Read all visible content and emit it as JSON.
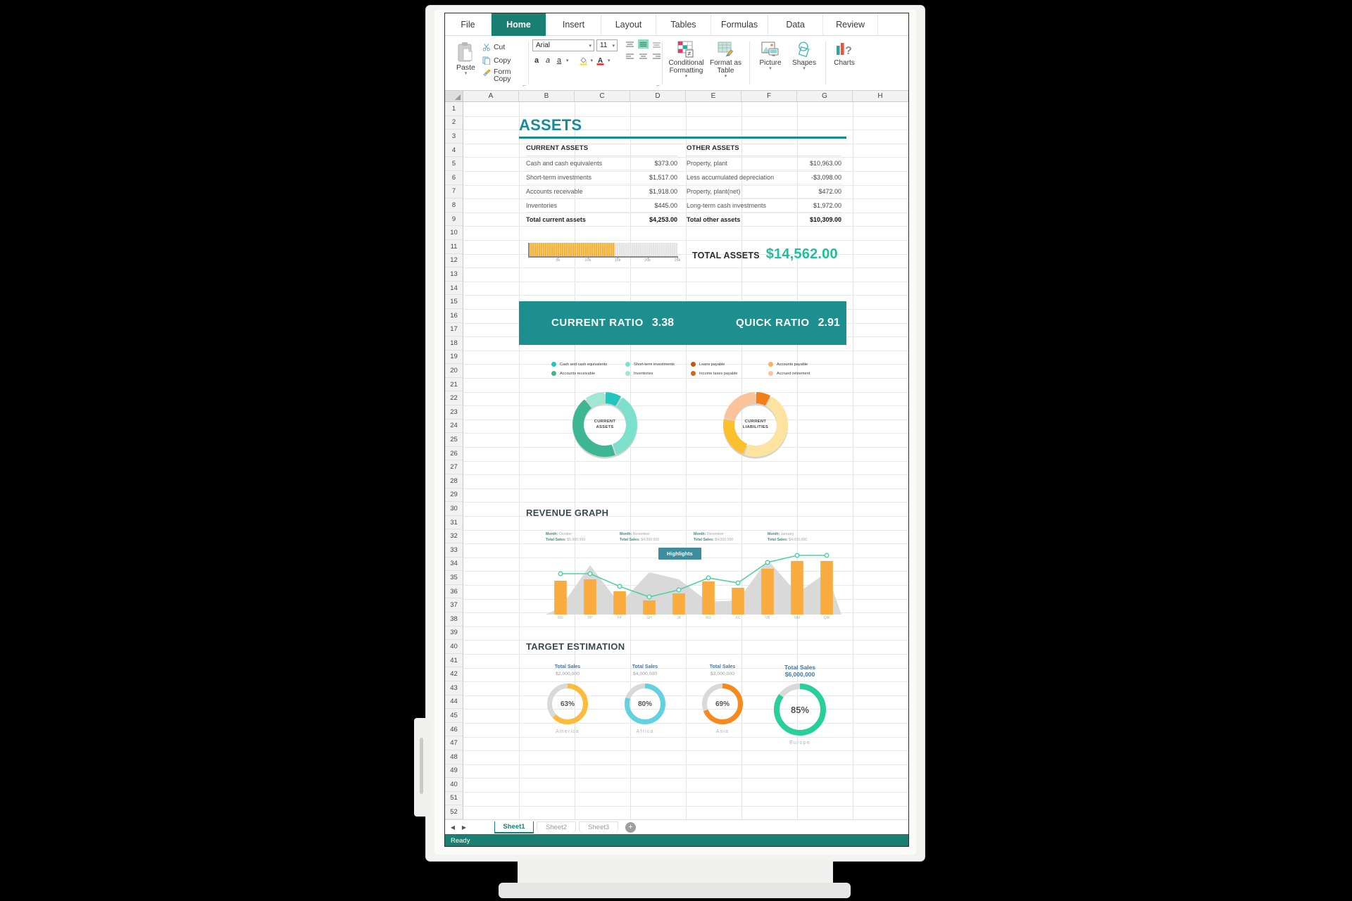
{
  "app": {
    "tabs": [
      {
        "label": "File",
        "active": false
      },
      {
        "label": "Home",
        "active": true
      },
      {
        "label": "Insert",
        "active": false
      },
      {
        "label": "Layout",
        "active": false
      },
      {
        "label": "Tables",
        "active": false
      },
      {
        "label": "Formulas",
        "active": false
      },
      {
        "label": "Data",
        "active": false
      },
      {
        "label": "Review",
        "active": false
      }
    ],
    "status": "Ready"
  },
  "ribbon": {
    "paste": "Paste",
    "cut": "Cut",
    "copy": "Copy",
    "form_copy": "Form Copy",
    "font_name": "Arial",
    "font_size": "11",
    "conditional_formatting": "Conditional Formatting",
    "format_as_table": "Format as Table",
    "picture": "Picture",
    "shapes": "Shapes",
    "charts": "Charts"
  },
  "grid": {
    "columns": [
      "A",
      "B",
      "C",
      "D",
      "E",
      "F",
      "G",
      "H"
    ],
    "rows": [
      "1",
      "2",
      "3",
      "4",
      "5",
      "6",
      "7",
      "8",
      "9",
      "10",
      "11",
      "12",
      "13",
      "14",
      "15",
      "16",
      "17",
      "18",
      "19",
      "20",
      "21",
      "22",
      "23",
      "24",
      "25",
      "26",
      "27",
      "28",
      "29",
      "30",
      "31",
      "32",
      "33",
      "34",
      "35",
      "36",
      "37",
      "38",
      "39",
      "40",
      "41",
      "42",
      "43",
      "44",
      "45",
      "46",
      "47",
      "48",
      "49",
      "40",
      "51",
      "52"
    ]
  },
  "sheets": {
    "tabs": [
      {
        "label": "Sheet1",
        "active": true
      },
      {
        "label": "Sheet2",
        "active": false
      },
      {
        "label": "Sheet3",
        "active": false
      }
    ],
    "add_label": "+"
  },
  "dashboard": {
    "title": "ASSETS",
    "current_assets": {
      "header": "CURRENT ASSETS",
      "rows": [
        {
          "label": "Cash and cash equivalents",
          "value": "$373.00"
        },
        {
          "label": "Short-term investments",
          "value": "$1,517.00"
        },
        {
          "label": "Accounts receivable",
          "value": "$1,918.00"
        },
        {
          "label": "Inventories",
          "value": "$445.00"
        }
      ],
      "total": {
        "label": "Total current assets",
        "value": "$4,253.00"
      }
    },
    "other_assets": {
      "header": "OTHER ASSETS",
      "rows": [
        {
          "label": "Property, plant",
          "value": "$10,963.00"
        },
        {
          "label": "Less accumulated depreciation",
          "value": "-$3,098.00"
        },
        {
          "label": "Property, plant(net)",
          "value": "$472.00"
        },
        {
          "label": "Long-term cash investments",
          "value": "$1,972.00"
        }
      ],
      "total": {
        "label": "Total other assets",
        "value": "$10,309.00"
      }
    },
    "total_assets": {
      "label": "TOTAL ASSETS",
      "value": "$14,562.00"
    },
    "ratios": [
      {
        "label": "CURRENT RATIO",
        "value": "3.38"
      },
      {
        "label": "QUICK RATIO",
        "value": "2.91"
      }
    ],
    "revenue_title": "REVENUE GRAPH",
    "highlights_label": "Highlights",
    "target_title": "TARGET ESTIMATION"
  },
  "chart_data": [
    {
      "type": "bar",
      "title": "Total Assets progress bar",
      "value": 14562,
      "xlim": [
        0,
        25000
      ],
      "tick_labels": [
        "5k",
        "10k",
        "15k",
        "20k",
        "25k"
      ],
      "tick_values": [
        5000,
        10000,
        15000,
        20000,
        25000
      ],
      "fill_color": "#f7b133",
      "track_color": "#e4e4e4"
    },
    {
      "type": "pie",
      "title": "CURRENT ASSETS",
      "center_label": "CURRENT ASSETS",
      "legend_position": "top",
      "labels": [
        "Cash and cash equivalents",
        "Short-term investments",
        "Accounts receivable",
        "Inventories"
      ],
      "values": [
        373,
        1517,
        1918,
        445
      ],
      "colors": [
        "#1fc7bd",
        "#7de0cd",
        "#3cb693",
        "#9fe8d3"
      ]
    },
    {
      "type": "pie",
      "title": "CURRENT LIABILITIES",
      "center_label": "CURRENT LIABILITIES",
      "legend_position": "top",
      "labels": [
        "Loans payable",
        "Accounts payable",
        "Income taxes payable",
        "Accrued retirement"
      ],
      "values": [
        8,
        48,
        22,
        22
      ],
      "colors": [
        "#ef8017",
        "#fde3a0",
        "#fcc02e",
        "#fbc39a"
      ]
    },
    {
      "type": "bar",
      "title": "REVENUE GRAPH",
      "categories": [
        "RG",
        "DP",
        "FP",
        "GH",
        "JK",
        "RG",
        "XC",
        "VB",
        "NM",
        "QW"
      ],
      "series": [
        {
          "name": "Bars",
          "type": "bar",
          "values": [
            48,
            50,
            33,
            20,
            30,
            47,
            38,
            65,
            76,
            76
          ],
          "color": "#f9ab3e"
        },
        {
          "name": "Trend",
          "type": "line",
          "values": [
            58,
            58,
            40,
            25,
            35,
            52,
            45,
            74,
            84,
            84
          ],
          "color": "#4fd1a5"
        },
        {
          "name": "Area",
          "type": "area",
          "values": [
            10,
            70,
            15,
            60,
            50,
            18,
            20,
            78,
            30,
            60
          ],
          "color": "#d9d9d9"
        }
      ],
      "ylim": [
        0,
        100
      ],
      "grid": false,
      "annotations": [
        {
          "label": "Month: October",
          "sub": "Total Sales: $5,000,000"
        },
        {
          "label": "Month: November",
          "sub": "Total Sales: $4,000,000"
        },
        {
          "label": "Month: December",
          "sub": "Total Sales: $4,000,000"
        },
        {
          "label": "Month: January",
          "sub": "Total Sales: $4,000,000"
        }
      ]
    },
    {
      "type": "pie",
      "title": "TARGET ESTIMATION",
      "subtype": "gauge-group",
      "items": [
        {
          "caption": "Total Sales",
          "amount": "$2,000,000",
          "percent": 63,
          "percent_label": "63%",
          "region": "America",
          "color": "#fcbb3c"
        },
        {
          "caption": "Total Sales",
          "amount": "$4,000,000",
          "percent": 80,
          "percent_label": "80%",
          "region": "Africa",
          "color": "#62d2e0"
        },
        {
          "caption": "Total Sales",
          "amount": "$3,000,000",
          "percent": 69,
          "percent_label": "69%",
          "region": "Asia",
          "color": "#f58a1e"
        },
        {
          "caption": "Total Sales",
          "amount": "$6,000,000",
          "percent": 85,
          "percent_label": "85%",
          "region": "Europe",
          "color": "#29cf9a"
        }
      ],
      "track_color": "#d9d9d9"
    }
  ],
  "revenue_months": [
    {
      "month_label": "Month:",
      "month": "October",
      "sales_label": "Total Sales:",
      "sales": "$5,000,000"
    },
    {
      "month_label": "Month:",
      "month": "November",
      "sales_label": "Total Sales:",
      "sales": "$4,000,000"
    },
    {
      "month_label": "Month:",
      "month": "December",
      "sales_label": "Total Sales:",
      "sales": "$4,000,000"
    },
    {
      "month_label": "Month:",
      "month": "January",
      "sales_label": "Total Sales:",
      "sales": "$4,000,000"
    }
  ],
  "legend": {
    "left": [
      {
        "label": "Cash and cash equivalents",
        "color": "#1fc7bd"
      },
      {
        "label": "Short-term investments",
        "color": "#7de0cd"
      },
      {
        "label": "Accounts receivable",
        "color": "#3cb693"
      },
      {
        "label": "Inventories",
        "color": "#9fe8d3"
      }
    ],
    "right": [
      {
        "label": "Loans payable",
        "color": "#c05413"
      },
      {
        "label": "Accounts payable",
        "color": "#f7b35c"
      },
      {
        "label": "Income taxes payable",
        "color": "#cc6a14"
      },
      {
        "label": "Accrued retirement",
        "color": "#fbc39a"
      }
    ]
  },
  "colors": {
    "accent_teal": "#1a7f73",
    "band_teal": "#1d8f8f",
    "title_teal": "#1a8a93",
    "total_green": "#1fbf9a",
    "orange": "#f7b133"
  }
}
